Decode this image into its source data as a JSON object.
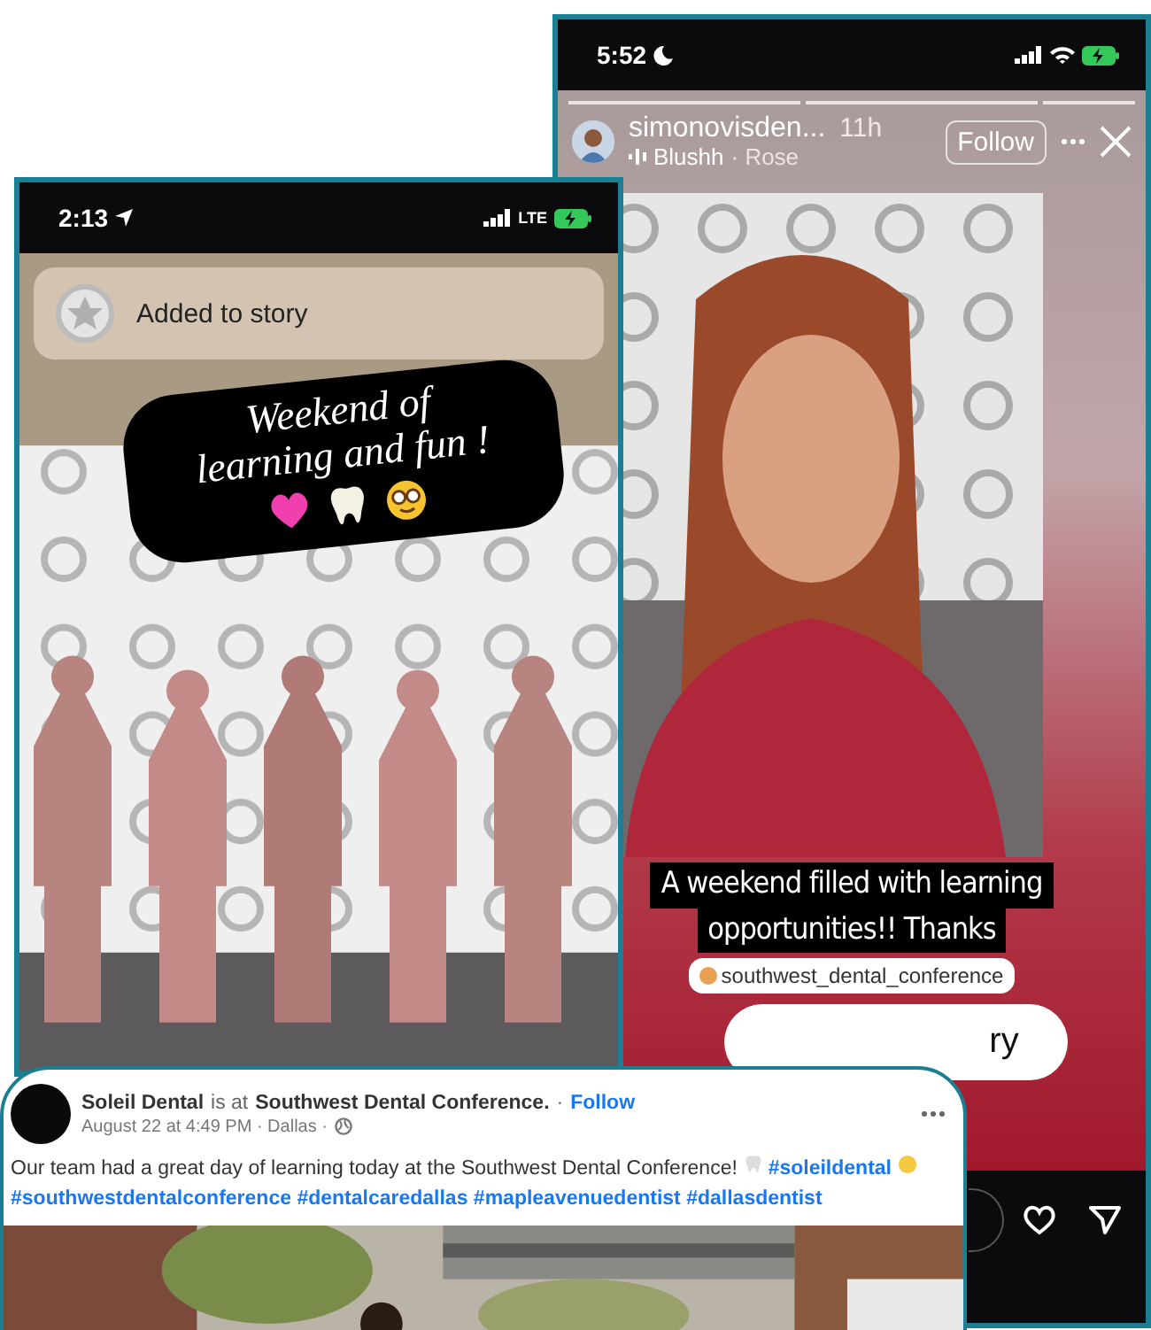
{
  "story_viewer": {
    "status_bar": {
      "time": "5:52"
    },
    "account": {
      "username": "simonovisden...",
      "time": "11h",
      "song": "Blushh",
      "artist": "· Rose"
    },
    "follow_button": "Follow",
    "caption_lines": [
      "A weekend filled with learning",
      "opportunities!! Thanks"
    ],
    "mention": "southwest_dental_conference",
    "sticker_button": "ry"
  },
  "story_camera": {
    "status_bar": {
      "time": "2:13",
      "network": "LTE"
    },
    "toast": "Added to story",
    "sticker_lines": [
      "Weekend of",
      "learning and fun !"
    ]
  },
  "post": {
    "author": "Soleil Dental",
    "relation": "is at",
    "place": "Southwest Dental Conference.",
    "separator": "·",
    "follow": "Follow",
    "meta": "August 22 at 4:49 PM · Dallas ·",
    "text": "Our team had a great day of learning today at the Southwest Dental Conference!",
    "hashtags": [
      "#soleildental",
      "#southwestdentalconference",
      "#dentalcaredallas",
      "#mapleavenuedentist",
      "#dallasdentist"
    ]
  }
}
